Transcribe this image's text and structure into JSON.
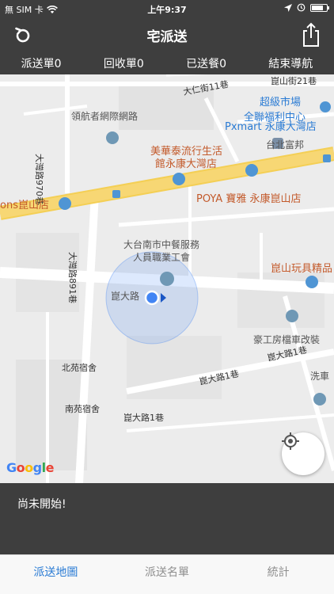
{
  "status_bar": {
    "carrier": "無 SIM 卡",
    "time": "上午9:37",
    "battery_level": 0.8
  },
  "nav": {
    "title": "宅派送"
  },
  "top_tabs": [
    "派送單0",
    "回收單0",
    "已送餐0",
    "結束導航"
  ],
  "map": {
    "labels": [
      {
        "text": "大仁街11巷",
        "cls": "dark"
      },
      {
        "text": "崑山街21巷",
        "cls": "dark"
      },
      {
        "text": "超級市場",
        "cls": "blue"
      },
      {
        "text": "全聯福利中心",
        "cls": "blue"
      },
      {
        "text": "Pxmart 永康大灣店",
        "cls": "blue"
      },
      {
        "text": "領航者網際網路",
        "cls": ""
      },
      {
        "text": "大灣路970巷",
        "cls": "dark"
      },
      {
        "text": "美華泰流行生活",
        "cls": "poi"
      },
      {
        "text": "館永康大灣店",
        "cls": "poi"
      },
      {
        "text": "台北富邦",
        "cls": ""
      },
      {
        "text": "ons崑山店",
        "cls": "poi"
      },
      {
        "text": "POYA 寶雅 永康崑山店",
        "cls": "poi"
      },
      {
        "text": "大灣路891巷",
        "cls": "dark"
      },
      {
        "text": "大台南市中餐服務",
        "cls": ""
      },
      {
        "text": "人員職業工會",
        "cls": ""
      },
      {
        "text": "崑山玩具精品",
        "cls": "poi"
      },
      {
        "text": "崑大路",
        "cls": ""
      },
      {
        "text": "豪工房檔車改裝",
        "cls": ""
      },
      {
        "text": "崑大路1巷",
        "cls": "dark"
      },
      {
        "text": "崑大路1巷",
        "cls": "dark"
      },
      {
        "text": "洗車",
        "cls": ""
      },
      {
        "text": "北苑宿舍",
        "cls": "dark"
      },
      {
        "text": "南苑宿舍",
        "cls": "dark"
      },
      {
        "text": "崑大路1巷",
        "cls": "dark"
      }
    ],
    "google_logo": "Google"
  },
  "status_message": "尚未開始!",
  "bottom_tabs": [
    "派送地圖",
    "派送名單",
    "統計"
  ],
  "colors": {
    "bar": "#3e3e3e",
    "accent": "#2a7bd4",
    "road_major": "#f7d774",
    "map_bg": "#ececec"
  }
}
